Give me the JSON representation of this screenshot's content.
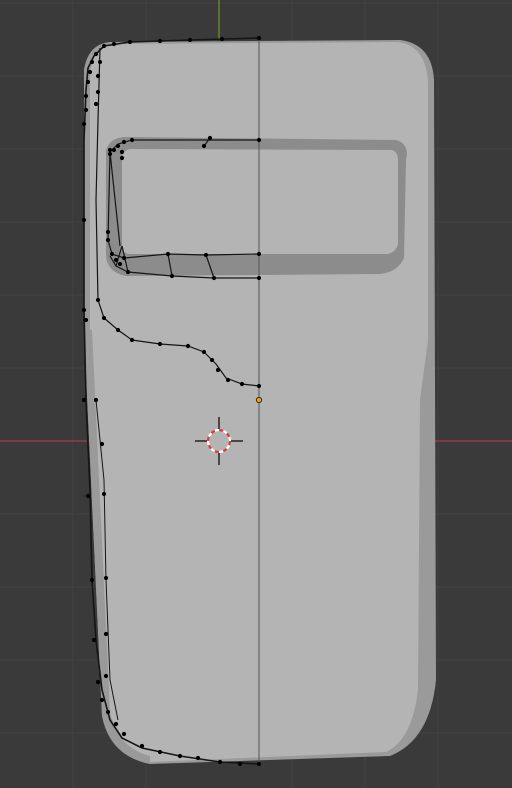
{
  "viewport": {
    "background_color": "#3a3a3a",
    "grid_color": "#434343",
    "x_axis_color": "#a83a48",
    "y_axis_color": "#6d9a1f",
    "mesh_fill_color": "#b4b4b4",
    "mesh_shade_color": "#9a9a9a",
    "window_recess_color": "#8c8c8c",
    "edge_color": "#151515",
    "vertex_color": "#000000",
    "origin_color": "#f0a030",
    "cursor_ring_colors": [
      "#e23a3a",
      "#ffffff"
    ],
    "cursor_cross_color": "#000000"
  },
  "scene_objects": {
    "riot_shield_mesh": "riot-shield-mesh",
    "mirror_seam": "mirror-center-seam",
    "object_origin": "object-origin-dot",
    "3d_cursor": "3d-cursor-icon"
  }
}
